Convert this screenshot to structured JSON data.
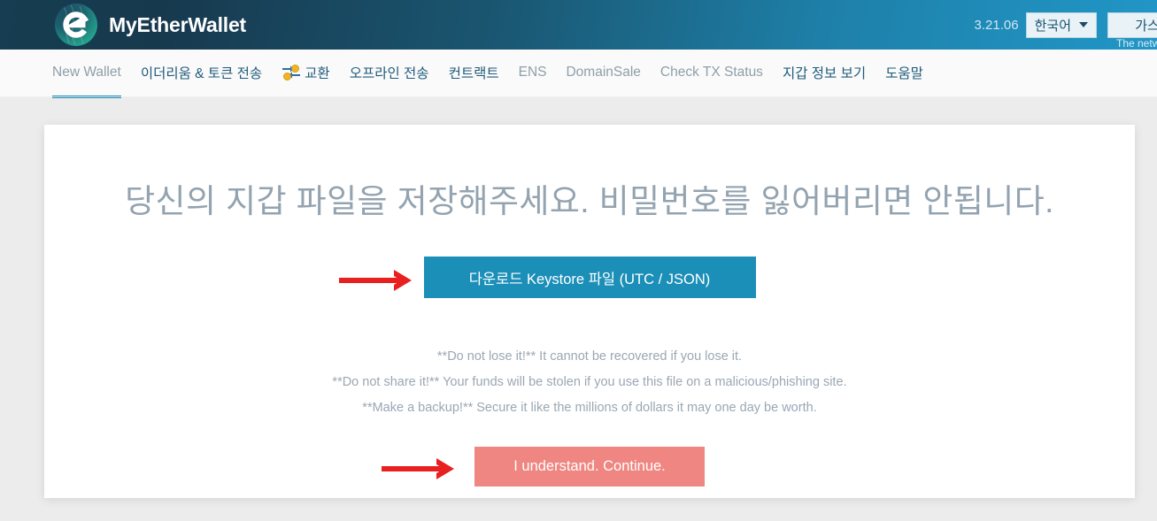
{
  "header": {
    "brand": "MyEtherWallet",
    "logo_icon": "mew-logo-icon",
    "version": "3.21.06",
    "language": "한국어",
    "caret_icon": "chevron-down-icon",
    "gas_button": "가스",
    "network_note": "The netw",
    "gradient_from": "#163d51",
    "gradient_to": "#2196c7"
  },
  "nav": {
    "items": [
      {
        "label": "New Wallet",
        "state": "active",
        "icon": null
      },
      {
        "label": "이더리움 & 토큰 전송",
        "state": "default",
        "icon": null
      },
      {
        "label": "교환",
        "state": "default",
        "icon": "swap-coins-icon"
      },
      {
        "label": "오프라인 전송",
        "state": "default",
        "icon": null
      },
      {
        "label": "컨트랙트",
        "state": "default",
        "icon": null
      },
      {
        "label": "ENS",
        "state": "muted",
        "icon": null
      },
      {
        "label": "DomainSale",
        "state": "muted",
        "icon": null
      },
      {
        "label": "Check TX Status",
        "state": "muted",
        "icon": null
      },
      {
        "label": "지갑 정보 보기",
        "state": "default",
        "icon": null
      },
      {
        "label": "도움말",
        "state": "default",
        "icon": null
      }
    ],
    "active_underline_color": "#1b89b5"
  },
  "main": {
    "headline": "당신의 지갑 파일을 저장해주세요. 비밀번호를 잃어버리면 안됩니다.",
    "download_button": "다운로드 Keystore 파일 (UTC / JSON)",
    "download_button_color": "#1b8fb8",
    "warnings": [
      "**Do not lose it!** It cannot be recovered if you lose it.",
      "**Do not share it!** Your funds will be stolen if you use this file on a malicious/phishing site.",
      "**Make a backup!** Secure it like the millions of dollars it may one day be worth."
    ],
    "continue_button": "I understand. Continue.",
    "continue_button_color": "#ef8681",
    "annotation_arrow_color": "#e8201f",
    "arrows": [
      {
        "name": "arrow-to-download-button"
      },
      {
        "name": "arrow-to-continue-button"
      }
    ]
  }
}
